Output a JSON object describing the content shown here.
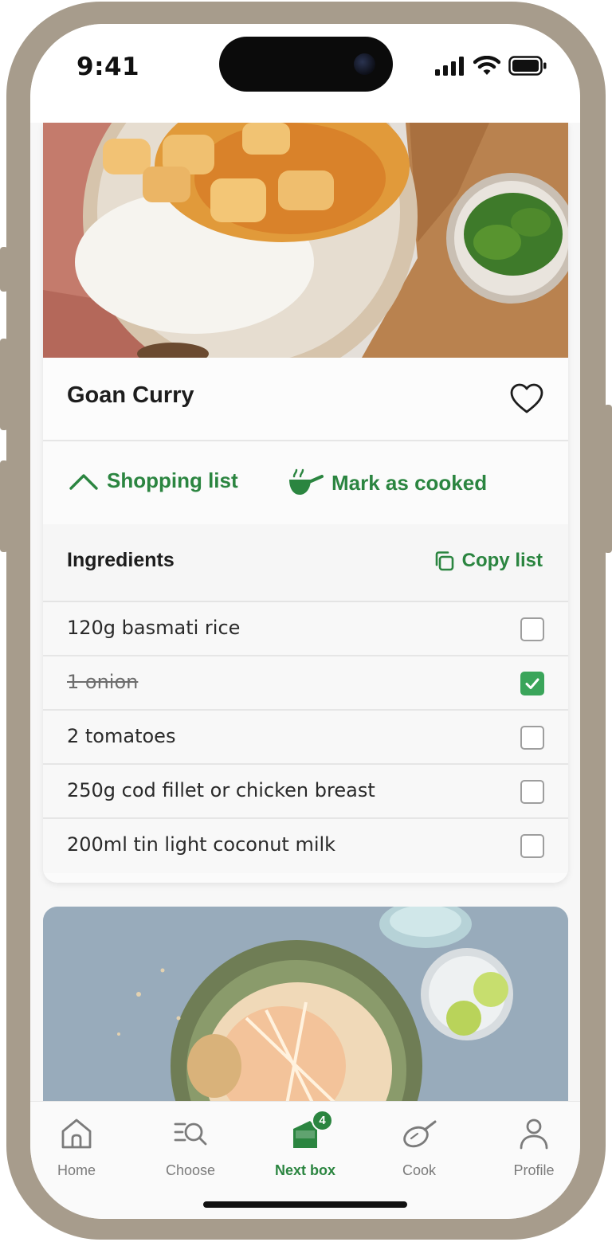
{
  "status_bar": {
    "time": "9:41"
  },
  "recipe1": {
    "title": "Goan Curry",
    "actions": {
      "shopping_list": "Shopping list",
      "mark_cooked": "Mark as cooked"
    },
    "ingredients": {
      "heading": "Ingredients",
      "copy_list": "Copy list",
      "items": [
        {
          "label": "120g basmati rice",
          "checked": false
        },
        {
          "label": "1 onion",
          "checked": true
        },
        {
          "label": "2 tomatoes",
          "checked": false
        },
        {
          "label": "250g cod fillet or chicken breast",
          "checked": false
        },
        {
          "label": "200ml tin light coconut milk",
          "checked": false
        }
      ]
    }
  },
  "bottom_nav": {
    "items": [
      {
        "label": "Home",
        "icon": "home-icon",
        "active": false
      },
      {
        "label": "Choose",
        "icon": "choose-icon",
        "active": false
      },
      {
        "label": "Next box",
        "icon": "box-icon",
        "active": true,
        "badge": "4"
      },
      {
        "label": "Cook",
        "icon": "pan-icon",
        "active": false
      },
      {
        "label": "Profile",
        "icon": "profile-icon",
        "active": false
      }
    ]
  },
  "colors": {
    "accent": "#2b8540",
    "frame": "#a79c8c",
    "checked": "#3aa55a"
  }
}
